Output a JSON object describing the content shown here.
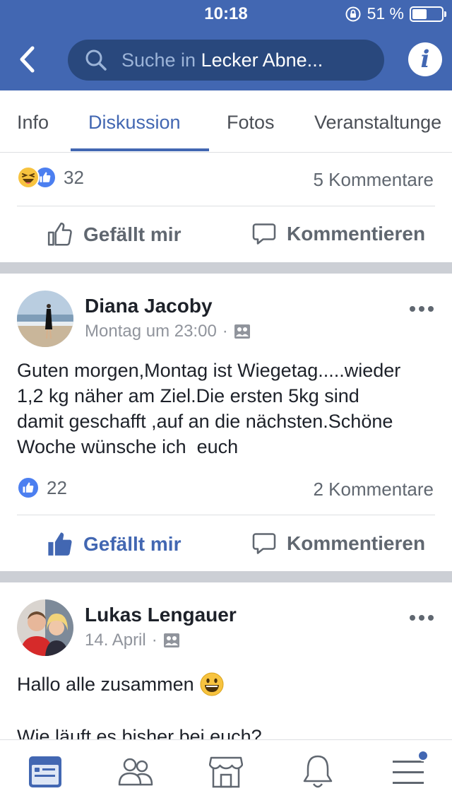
{
  "status_bar": {
    "time": "10:18",
    "battery_text": "51 %",
    "battery_level": 0.51
  },
  "header": {
    "search_prefix": "Suche in ",
    "search_group": "Lecker Abne...",
    "info_glyph": "i"
  },
  "tabs": [
    {
      "label": "Info",
      "active": false
    },
    {
      "label": "Diskussion",
      "active": true
    },
    {
      "label": "Fotos",
      "active": false
    },
    {
      "label": "Veranstaltunge",
      "active": false
    }
  ],
  "feed": {
    "post0": {
      "reaction_count": "32",
      "comments": "5 Kommentare",
      "like_label": "Gefällt mir",
      "comment_label": "Kommentieren",
      "reactions": [
        "haha-icon",
        "like-icon"
      ]
    },
    "post1": {
      "author": "Diana Jacoby",
      "time": "Montag um 23:00",
      "dot": "·",
      "text_lines": [
        "Guten morgen,Montag ist Wiegetag.....wieder",
        "1,2 kg näher am Ziel.Die ersten 5kg sind",
        "damit geschafft ,auf an die nächsten.Schöne",
        "Woche wünsche ich  euch"
      ],
      "reaction_count": "22",
      "comments": "2 Kommentare",
      "like_label": "Gefällt mir",
      "comment_label": "Kommentieren",
      "liked": true
    },
    "post2": {
      "author": "Lukas Lengauer",
      "time": "14. April",
      "dot": "·",
      "text_line1": "Hallo alle zusammen",
      "text_line2": "Wie läuft es bisher bei euch?"
    }
  },
  "bottom_nav": [
    "feed-icon",
    "groups-icon",
    "marketplace-icon",
    "notifications-icon",
    "menu-icon"
  ],
  "colors": {
    "brand": "#4267b2",
    "search_bg": "#29487d",
    "separator": "#cccfd5",
    "muted_text": "#606770"
  }
}
